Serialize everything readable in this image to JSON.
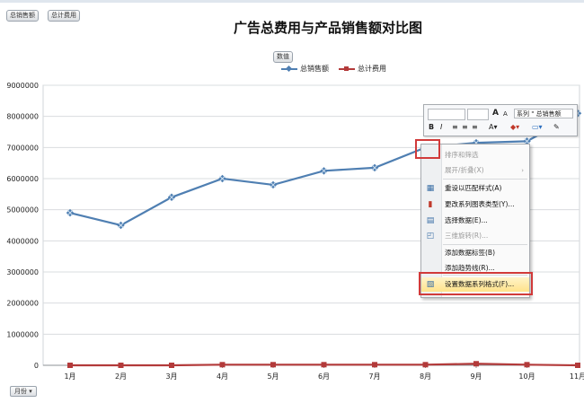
{
  "header": {
    "tags": [
      "总销售额",
      "总计费用"
    ],
    "data_button": "数值"
  },
  "chart_data": {
    "type": "line",
    "title": "广告总费用与产品销售额对比图",
    "categories": [
      "1月",
      "2月",
      "3月",
      "4月",
      "5月",
      "6月",
      "7月",
      "8月",
      "9月",
      "10月",
      "11月"
    ],
    "ylim": [
      0,
      9000000
    ],
    "yticks": [
      "0",
      "1000000",
      "2000000",
      "3000000",
      "4000000",
      "5000000",
      "6000000",
      "7000000",
      "8000000",
      "9000000"
    ],
    "grid": true,
    "legend_position": "top-center",
    "series": [
      {
        "name": "总销售额",
        "color": "#4f7fb2",
        "values": [
          4900000,
          4500000,
          5400000,
          6000000,
          5800000,
          6250000,
          6350000,
          7000000,
          7150000,
          7200000,
          8100000
        ]
      },
      {
        "name": "总计费用",
        "color": "#b33a3a",
        "values": [
          0,
          0,
          0,
          20000,
          20000,
          20000,
          20000,
          20000,
          50000,
          20000,
          0
        ]
      }
    ]
  },
  "axis_filter": {
    "label": "月份"
  },
  "minitoolbar": {
    "series_label": "系列 \" 总销售额",
    "grow_font": "A",
    "shrink_font": "A",
    "bold": "B",
    "italic": "I"
  },
  "context_menu": {
    "items": [
      {
        "label": "排序和筛选",
        "disabled": true,
        "icon": ""
      },
      {
        "label": "展开/折叠(X)",
        "disabled": true,
        "icon": "",
        "submenu": true
      },
      {
        "label": "重设以匹配样式(A)",
        "disabled": false,
        "icon": "reset-style-icon"
      },
      {
        "label": "更改系列图表类型(Y)...",
        "disabled": false,
        "icon": "chart-type-icon"
      },
      {
        "label": "选择数据(E)...",
        "disabled": false,
        "icon": "select-data-icon"
      },
      {
        "label": "三维旋转(R)...",
        "disabled": true,
        "icon": "rotate-3d-icon"
      },
      {
        "label": "添加数据标签(B)",
        "disabled": false,
        "icon": ""
      },
      {
        "label": "添加趋势线(R)...",
        "disabled": false,
        "icon": ""
      },
      {
        "label": "设置数据系列格式(F)...",
        "disabled": false,
        "icon": "format-series-icon",
        "highlight": true
      }
    ]
  }
}
